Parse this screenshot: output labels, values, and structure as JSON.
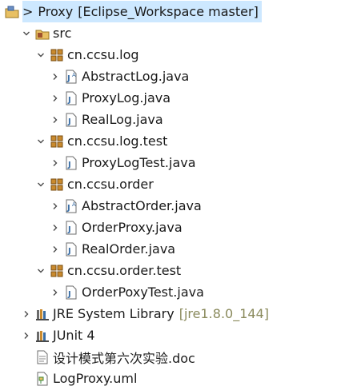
{
  "project": {
    "prefix": ">",
    "name": "Proxy",
    "decoration": "[Eclipse_Workspace master]"
  },
  "tree": {
    "src": "src",
    "packages": [
      {
        "name": "cn.ccsu.log",
        "files": [
          "AbstractLog.java",
          "ProxyLog.java",
          "RealLog.java"
        ]
      },
      {
        "name": "cn.ccsu.log.test",
        "files": [
          "ProxyLogTest.java"
        ]
      },
      {
        "name": "cn.ccsu.order",
        "files": [
          "AbstractOrder.java",
          "OrderProxy.java",
          "RealOrder.java"
        ]
      },
      {
        "name": "cn.ccsu.order.test",
        "files": [
          "OrderPoxyTest.java"
        ]
      }
    ],
    "jre": {
      "label": "JRE System Library",
      "decoration": "[jre1.8.0_144]"
    },
    "junit": "JUnit 4",
    "doc": "设计模式第六次实验.doc",
    "uml": "LogProxy.uml"
  },
  "colors": {
    "selection": "#cde8ff",
    "package": "#b07a2a",
    "java_file": "#3a6ea5",
    "decoration": "#8a8a5c",
    "chevron": "#4a4a4a"
  },
  "icons": {
    "project": "project-folder-icon",
    "src": "source-folder-icon",
    "package": "package-icon",
    "java": "java-file-icon",
    "library": "library-icon",
    "doc": "document-icon",
    "uml": "uml-file-icon"
  }
}
